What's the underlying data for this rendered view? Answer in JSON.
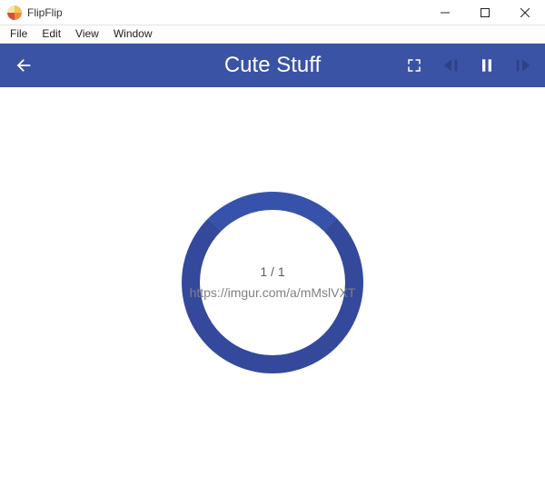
{
  "window": {
    "title": "FlipFlip"
  },
  "menu": {
    "file": "File",
    "edit": "Edit",
    "view": "View",
    "window": "Window"
  },
  "header": {
    "title": "Cute Stuff"
  },
  "loader": {
    "counter": "1 / 1",
    "url": "https://imgur.com/a/mMslVXT"
  }
}
